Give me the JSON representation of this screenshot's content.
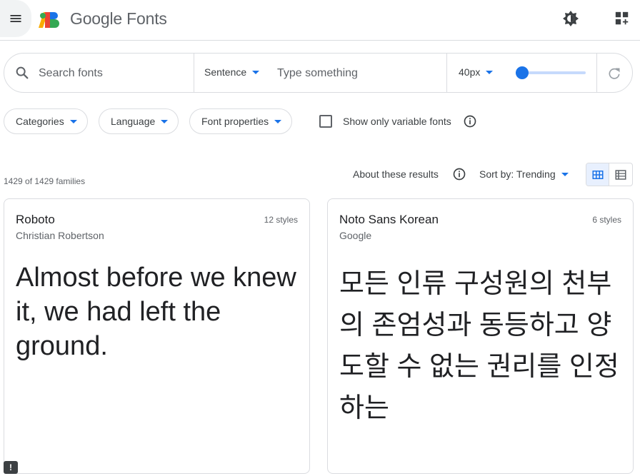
{
  "header": {
    "brand_google": "Google",
    "brand_fonts": "Fonts",
    "menu_icon": "hamburger-icon",
    "theme_icon": "brightness-icon",
    "apps_icon": "add-apps-icon"
  },
  "search": {
    "placeholder": "Search fonts",
    "preview_mode": "Sentence",
    "preview_placeholder": "Type something",
    "size_label": "40px",
    "size_slider_fraction": 0.05,
    "reset_icon": "refresh-icon"
  },
  "filters": {
    "categories": "Categories",
    "language": "Language",
    "font_properties": "Font properties",
    "variable_only": "Show only variable fonts",
    "variable_checked": false
  },
  "results": {
    "count": "1429 of 1429 families",
    "about": "About these results",
    "sort": "Sort by: Trending",
    "view": "grid"
  },
  "cards": [
    {
      "name": "Roboto",
      "author": "Christian Robertson",
      "styles": "12 styles",
      "preview": "Almost before we knew it, we had left the ground."
    },
    {
      "name": "Noto Sans Korean",
      "author": "Google",
      "styles": "6 styles",
      "preview": "모든 인류 구성원의 천부의 존엄성과 동등하고 양도할 수 없는 권리를 인정하는"
    }
  ],
  "feedback": "!",
  "colors": {
    "accent": "#1a73e8",
    "text": "#202124",
    "secondary": "#5f6368",
    "border": "#dadce0"
  }
}
